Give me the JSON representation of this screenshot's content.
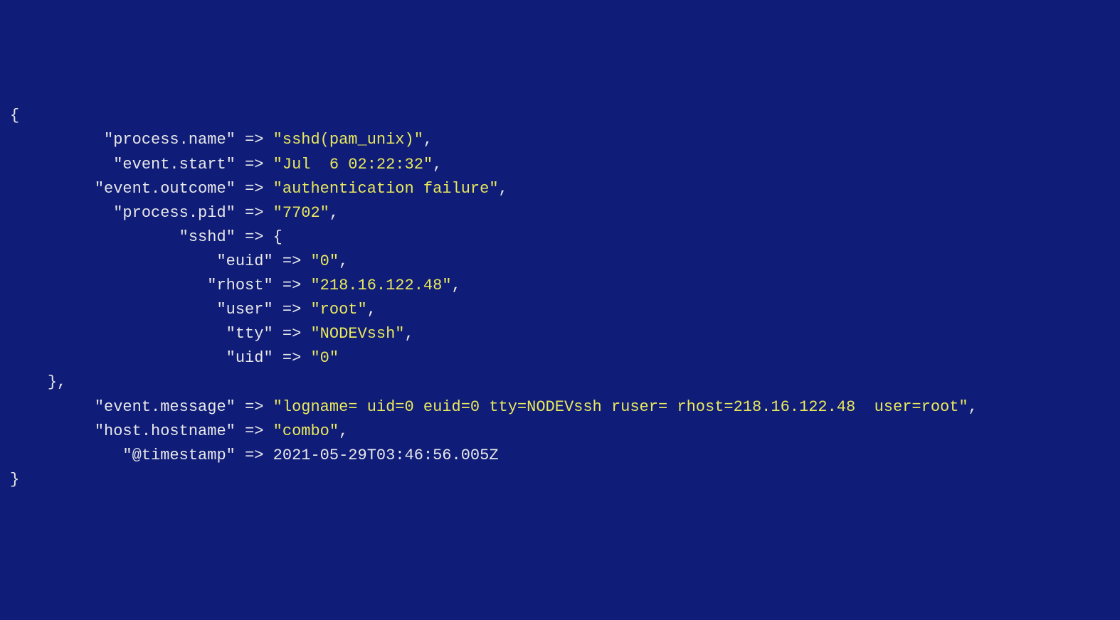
{
  "entries": [
    {
      "key": "process.name",
      "value": "sshd(pam_unix)",
      "quoted": true
    },
    {
      "key": "event.start",
      "value": "Jul  6 02:22:32",
      "quoted": true
    },
    {
      "key": "event.outcome",
      "value": "authentication failure",
      "quoted": true
    },
    {
      "key": "process.pid",
      "value": "7702",
      "quoted": true
    }
  ],
  "sshd_label": "sshd",
  "sshd": [
    {
      "key": "euid",
      "value": "0",
      "quoted": true
    },
    {
      "key": "rhost",
      "value": "218.16.122.48",
      "quoted": true
    },
    {
      "key": "user",
      "value": "root",
      "quoted": true
    },
    {
      "key": "tty",
      "value": "NODEVssh",
      "quoted": true
    },
    {
      "key": "uid",
      "value": "0",
      "quoted": true
    }
  ],
  "trailing": [
    {
      "key": "event.message",
      "value": "logname= uid=0 euid=0 tty=NODEVssh ruser= rhost=218.16.122.48  user=root",
      "quoted": true
    },
    {
      "key": "host.hostname",
      "value": "combo",
      "quoted": true
    },
    {
      "key": "@timestamp",
      "value": "2021-05-29T03:46:56.005Z",
      "quoted": false
    }
  ],
  "arrow_col_outer": 24,
  "arrow_col_inner": 20
}
